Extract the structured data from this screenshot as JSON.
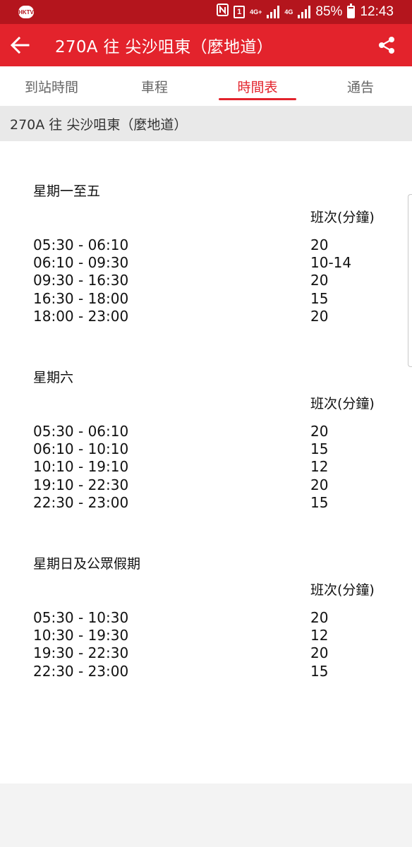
{
  "status_bar": {
    "app_icon": "HKTV",
    "sim_label": "1",
    "net1": "4G+",
    "net2": "4G",
    "battery": "85%",
    "battery_level": 0.85,
    "time": "12:43"
  },
  "app_bar": {
    "title": "270A 往 尖沙咀東（麼地道）",
    "accent": "#e3232c",
    "status_color": "#b4151d"
  },
  "tabs": [
    {
      "label": "到站時間",
      "active": false
    },
    {
      "label": "車程",
      "active": false
    },
    {
      "label": "時間表",
      "active": true
    },
    {
      "label": "通告",
      "active": false
    }
  ],
  "route_header": "270A 往 尖沙咀東（麼地道）",
  "timetable": [
    {
      "title": "星期一至五",
      "freq_header": "班次(分鐘)",
      "rows": [
        {
          "time": "05:30 - 06:10",
          "freq": "20"
        },
        {
          "time": "06:10 - 09:30",
          "freq": "10-14"
        },
        {
          "time": "09:30 - 16:30",
          "freq": "20"
        },
        {
          "time": "16:30 - 18:00",
          "freq": "15"
        },
        {
          "time": "18:00 - 23:00",
          "freq": "20"
        }
      ]
    },
    {
      "title": "星期六",
      "freq_header": "班次(分鐘)",
      "rows": [
        {
          "time": "05:30 - 06:10",
          "freq": "20"
        },
        {
          "time": "06:10 - 10:10",
          "freq": "15"
        },
        {
          "time": "10:10 - 19:10",
          "freq": "12"
        },
        {
          "time": "19:10 - 22:30",
          "freq": "20"
        },
        {
          "time": "22:30 - 23:00",
          "freq": "15"
        }
      ]
    },
    {
      "title": "星期日及公眾假期",
      "freq_header": "班次(分鐘)",
      "rows": [
        {
          "time": "05:30 - 10:30",
          "freq": "20"
        },
        {
          "time": "10:30 - 19:30",
          "freq": "12"
        },
        {
          "time": "19:30 - 22:30",
          "freq": "20"
        },
        {
          "time": "22:30 - 23:00",
          "freq": "15"
        }
      ]
    }
  ]
}
